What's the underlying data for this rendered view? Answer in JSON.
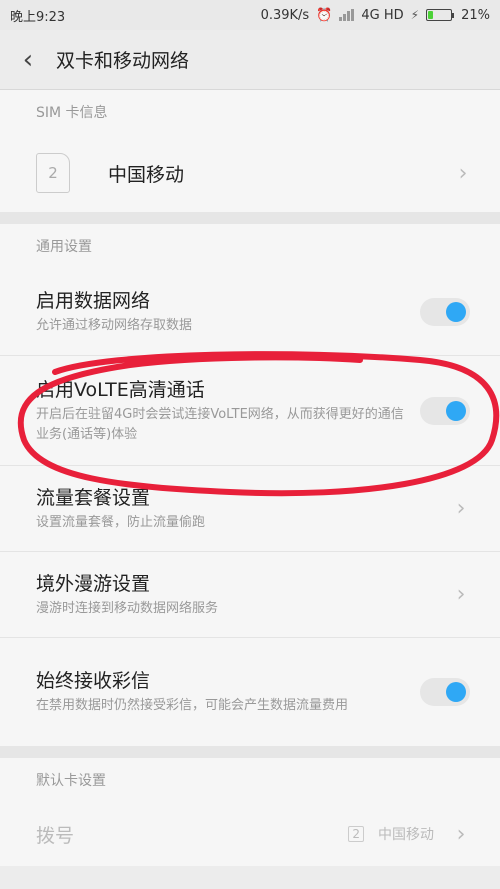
{
  "status": {
    "time": "晚上9:23",
    "speed": "0.39K/s",
    "network": "4G HD",
    "battery": "21%",
    "battery_fraction": 0.21,
    "icons": [
      "alarm-icon",
      "signal-icon",
      "charging-icon",
      "battery-icon"
    ]
  },
  "header": {
    "title": "双卡和移动网络",
    "back_icon": "back-chevron-icon"
  },
  "sim_section": {
    "label": "SIM 卡信息",
    "card_number": "2",
    "carrier": "中国移动"
  },
  "general_section": {
    "label": "通用设置",
    "items": [
      {
        "title": "启用数据网络",
        "subtitle": "允许通过移动网络存取数据",
        "control": "toggle",
        "on": true
      },
      {
        "title": "启用VoLTE高清通话",
        "subtitle": "开启后在驻留4G时会尝试连接VoLTE网络，从而获得更好的通信业务(通话等)体验",
        "control": "toggle",
        "on": true
      },
      {
        "title": "流量套餐设置",
        "subtitle": "设置流量套餐，防止流量偷跑",
        "control": "chevron"
      },
      {
        "title": "境外漫游设置",
        "subtitle": "漫游时连接到移动数据网络服务",
        "control": "chevron"
      },
      {
        "title": "始终接收彩信",
        "subtitle": "在禁用数据时仍然接受彩信，可能会产生数据流量费用",
        "control": "toggle",
        "on": true
      }
    ]
  },
  "default_section": {
    "label": "默认卡设置",
    "dial": {
      "label": "拨号",
      "sim": "2",
      "value": "中国移动"
    }
  },
  "colors": {
    "accent": "#2fa8f5",
    "annotation": "#e8203a",
    "battery": "#4cd137"
  }
}
